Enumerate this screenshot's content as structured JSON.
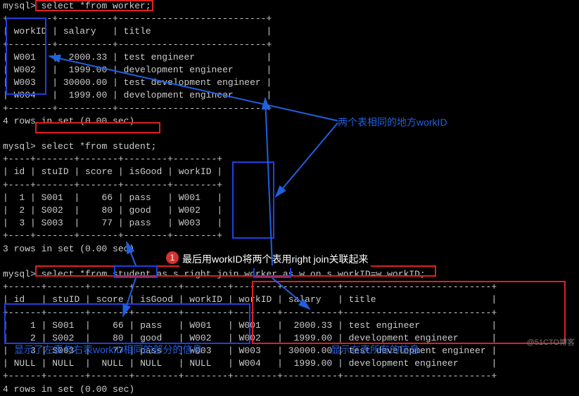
{
  "prompt": "mysql>",
  "queries": {
    "q1": "select *from worker;",
    "q2": "select *from student;",
    "q3": "select *from student as s right join worker as w on s.workID=w.workID;"
  },
  "worker_table": {
    "headers": [
      "workID",
      "salary",
      "title"
    ],
    "rows": [
      [
        "W001",
        "2000.33",
        "test engineer"
      ],
      [
        "W002",
        "1999.00",
        "development engineer"
      ],
      [
        "W003",
        "30000.00",
        "test development engineer"
      ],
      [
        "W004",
        "1999.00",
        "development engineer"
      ]
    ],
    "footer": "4 rows in set (0.00 sec)"
  },
  "student_table": {
    "headers": [
      "id",
      "stuID",
      "score",
      "isGood",
      "workID"
    ],
    "rows": [
      [
        "1",
        "S001",
        "66",
        "pass",
        "W001"
      ],
      [
        "2",
        "S002",
        "80",
        "good",
        "W002"
      ],
      [
        "3",
        "S003",
        "77",
        "pass",
        "W003"
      ]
    ],
    "footer": "3 rows in set (0.00 sec)"
  },
  "join_table": {
    "headers": [
      "id",
      "stuID",
      "score",
      "isGood",
      "workID",
      "workID",
      "salary",
      "title"
    ],
    "rows": [
      [
        "1",
        "S001",
        "66",
        "pass",
        "W001",
        "W001",
        "2000.33",
        "test engineer"
      ],
      [
        "2",
        "S002",
        "80",
        "good",
        "W002",
        "W002",
        "1999.00",
        "development engineer"
      ],
      [
        "3",
        "S003",
        "77",
        "pass",
        "W003",
        "W003",
        "30000.00",
        "test development engineer"
      ],
      [
        "NULL",
        "NULL",
        "NULL",
        "NULL",
        "NULL",
        "W004",
        "1999.00",
        "development engineer"
      ]
    ],
    "footer": "4 rows in set (0.00 sec)"
  },
  "annotations": {
    "same_col": "两个表相同的地方workID",
    "step_label": "1",
    "final_desc": "最后用workID将两个表用right join关联起来",
    "left_desc": "显示了左表与右表workID相同的部分的信息",
    "right_desc": "显示右表所有的信息"
  },
  "watermark": "@51CTO博客"
}
